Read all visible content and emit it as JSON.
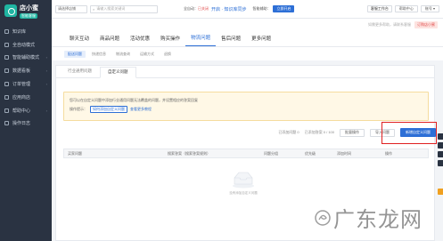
{
  "brand": {
    "name": "店小蜜",
    "badge": "智能客服"
  },
  "sidebar": {
    "items": [
      {
        "label": "知识库",
        "chevron": ""
      },
      {
        "label": "全自动模式",
        "chevron": ""
      },
      {
        "label": "智能辅助模式",
        "chevron": "›"
      },
      {
        "label": "数据看板",
        "chevron": "›"
      },
      {
        "label": "订单管理",
        "chevron": "›"
      },
      {
        "label": "应用商店",
        "chevron": ""
      },
      {
        "label": "帮助中心",
        "chevron": "›"
      },
      {
        "label": "操作日志",
        "chevron": ""
      }
    ]
  },
  "topbar": {
    "select": "请选择店铺",
    "search_placeholder": "请输入搜索关键词",
    "status_prefix": "全自动：",
    "status_value": "已关闭",
    "status_link": "开启 · 知识库同步",
    "assist_label": "智能辅助：",
    "open_button": "立即开启",
    "sales_button": "客服工作台",
    "help_button": "帮助中心",
    "user_button": "账号 ▾"
  },
  "subbar": {
    "text": "如需更多帮助，请联系客服",
    "button": "订购店小蜜"
  },
  "main_tabs": [
    "聊天互动",
    "商品问题",
    "活动优惠",
    "购买操作",
    "物流问题",
    "售后问题",
    "更多问题"
  ],
  "sub_tabs": [
    "配送问题",
    "快递信息",
    "物流查询",
    "运输方式",
    "退换"
  ],
  "panel": {
    "tabs": [
      "行业通用问题",
      "自定义问题"
    ],
    "notice_line1": "您可以在自定义问题中添加行业通用问题无法覆盖的问题，并设置相应的答案回复",
    "notice_prefix": "操作提示：",
    "notice_button": "如何添加自定义问题",
    "notice_link": "查看更多教程",
    "toolbar": {
      "stat1": "已添加问题 0",
      "stat2": "已添加答案 0 / 100",
      "batch": "批量操作",
      "import": "导入问题",
      "create": "新增自定义问题"
    },
    "columns": [
      "买家问题",
      "",
      "搜索答案（搜索答案规则）",
      "问题分组",
      "优先级",
      "添加时间",
      "操作"
    ],
    "empty_text": "没有添加自定义问题"
  },
  "watermark": "广东龙网"
}
